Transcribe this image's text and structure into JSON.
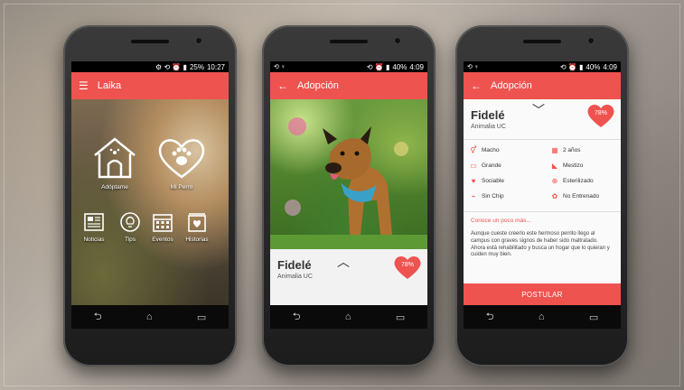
{
  "colors": {
    "accent": "#ef5350"
  },
  "phones": [
    {
      "status": {
        "icons": "⚙ ⟲ ⏰ ▮",
        "battery": "25%",
        "time": "10:27"
      },
      "appbar": {
        "title": "Laika",
        "menu_icon": "menu-icon"
      },
      "home": {
        "tiles": [
          {
            "label": "Adóptame",
            "icon": "doghouse-icon"
          },
          {
            "label": "Mi Perro",
            "icon": "paw-heart-icon"
          }
        ],
        "small_tiles": [
          {
            "label": "Noticias",
            "icon": "newspaper-icon"
          },
          {
            "label": "Tips",
            "icon": "lightbulb-icon"
          },
          {
            "label": "Eventos",
            "icon": "calendar-icon"
          },
          {
            "label": "Historias",
            "icon": "book-heart-icon"
          }
        ]
      }
    },
    {
      "status": {
        "left": "⟲ ♀",
        "icons": "⟲ ⏰ ▮",
        "battery": "40%",
        "time": "4:09"
      },
      "appbar": {
        "title": "Adopción"
      },
      "pet": {
        "name": "Fidelé",
        "org": "Animalia UC",
        "match": "78%"
      }
    },
    {
      "status": {
        "left": "⟲ ♀",
        "icons": "⟲ ⏰ ▮",
        "battery": "40%",
        "time": "4:09"
      },
      "appbar": {
        "title": "Adopción"
      },
      "pet": {
        "name": "Fidelé",
        "org": "Animalia UC",
        "match": "78%"
      },
      "attributes": [
        {
          "label": "Macho",
          "icon": "male-icon"
        },
        {
          "label": "2 años",
          "icon": "calendar-icon"
        },
        {
          "label": "Grande",
          "icon": "ruler-icon"
        },
        {
          "label": "Mestizo",
          "icon": "dog-icon"
        },
        {
          "label": "Sociable",
          "icon": "heart-icon"
        },
        {
          "label": "Esterilizado",
          "icon": "cross-circle-icon"
        },
        {
          "label": "Sin Chip",
          "icon": "chip-icon"
        },
        {
          "label": "No Entrenado",
          "icon": "paw-icon"
        }
      ],
      "more_link": "Conoce un poco más...",
      "description": "Aunque cueste creerlo este hermoso perrito llego al campus con graves signos de haber sido maltratado. Ahora está rehabilitado y busca un hogar que lo quieran y cuiden muy bien.",
      "cta": "POSTULAR"
    }
  ]
}
